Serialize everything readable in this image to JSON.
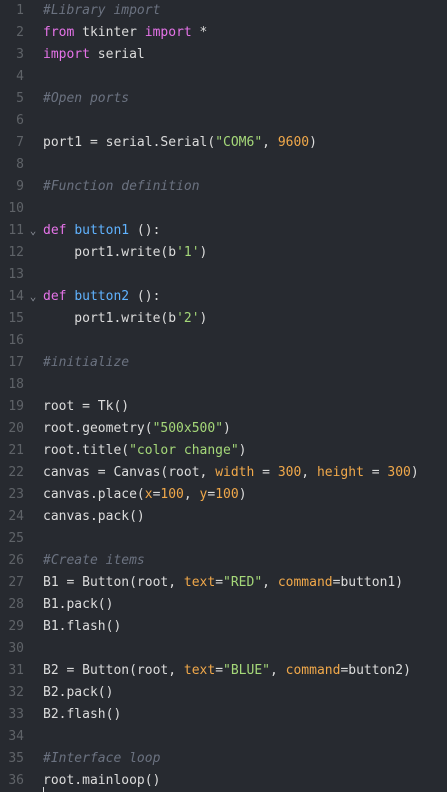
{
  "lines": [
    {
      "n": "1",
      "fold": "",
      "tokens": [
        {
          "c": "cm",
          "t": "#Library import"
        }
      ]
    },
    {
      "n": "2",
      "fold": "",
      "tokens": [
        {
          "c": "kw",
          "t": "from"
        },
        {
          "c": "txt",
          "t": " tkinter "
        },
        {
          "c": "kw",
          "t": "import"
        },
        {
          "c": "txt",
          "t": " *"
        }
      ]
    },
    {
      "n": "3",
      "fold": "",
      "tokens": [
        {
          "c": "kw",
          "t": "import"
        },
        {
          "c": "txt",
          "t": " serial"
        }
      ]
    },
    {
      "n": "4",
      "fold": "",
      "tokens": []
    },
    {
      "n": "5",
      "fold": "",
      "tokens": [
        {
          "c": "cm",
          "t": "#Open ports"
        }
      ]
    },
    {
      "n": "6",
      "fold": "",
      "tokens": []
    },
    {
      "n": "7",
      "fold": "",
      "tokens": [
        {
          "c": "txt",
          "t": "port1 = serial.Serial("
        },
        {
          "c": "str",
          "t": "\"COM6\""
        },
        {
          "c": "txt",
          "t": ", "
        },
        {
          "c": "num",
          "t": "9600"
        },
        {
          "c": "txt",
          "t": ")"
        }
      ]
    },
    {
      "n": "8",
      "fold": "",
      "tokens": []
    },
    {
      "n": "9",
      "fold": "",
      "tokens": [
        {
          "c": "cm",
          "t": "#Function definition"
        }
      ]
    },
    {
      "n": "10",
      "fold": "",
      "tokens": []
    },
    {
      "n": "11",
      "fold": "v",
      "tokens": [
        {
          "c": "kw",
          "t": "def"
        },
        {
          "c": "txt",
          "t": " "
        },
        {
          "c": "fn",
          "t": "button1"
        },
        {
          "c": "txt",
          "t": " ():"
        }
      ]
    },
    {
      "n": "12",
      "fold": "",
      "tokens": [
        {
          "c": "txt",
          "t": "    port1.write(b"
        },
        {
          "c": "str",
          "t": "'1'"
        },
        {
          "c": "txt",
          "t": ")"
        }
      ]
    },
    {
      "n": "13",
      "fold": "",
      "tokens": []
    },
    {
      "n": "14",
      "fold": "v",
      "tokens": [
        {
          "c": "kw",
          "t": "def"
        },
        {
          "c": "txt",
          "t": " "
        },
        {
          "c": "fn",
          "t": "button2"
        },
        {
          "c": "txt",
          "t": " ():"
        }
      ]
    },
    {
      "n": "15",
      "fold": "",
      "tokens": [
        {
          "c": "txt",
          "t": "    port1.write(b"
        },
        {
          "c": "str",
          "t": "'2'"
        },
        {
          "c": "txt",
          "t": ")"
        }
      ]
    },
    {
      "n": "16",
      "fold": "",
      "tokens": []
    },
    {
      "n": "17",
      "fold": "",
      "tokens": [
        {
          "c": "cm",
          "t": "#initialize"
        }
      ]
    },
    {
      "n": "18",
      "fold": "",
      "tokens": []
    },
    {
      "n": "19",
      "fold": "",
      "tokens": [
        {
          "c": "txt",
          "t": "root = Tk()"
        }
      ]
    },
    {
      "n": "20",
      "fold": "",
      "tokens": [
        {
          "c": "txt",
          "t": "root.geometry("
        },
        {
          "c": "str",
          "t": "\"500x500\""
        },
        {
          "c": "txt",
          "t": ")"
        }
      ]
    },
    {
      "n": "21",
      "fold": "",
      "tokens": [
        {
          "c": "txt",
          "t": "root.title("
        },
        {
          "c": "str",
          "t": "\"color change\""
        },
        {
          "c": "txt",
          "t": ")"
        }
      ]
    },
    {
      "n": "22",
      "fold": "",
      "tokens": [
        {
          "c": "txt",
          "t": "canvas = Canvas(root, "
        },
        {
          "c": "param",
          "t": "width"
        },
        {
          "c": "txt",
          "t": " = "
        },
        {
          "c": "num",
          "t": "300"
        },
        {
          "c": "txt",
          "t": ", "
        },
        {
          "c": "param",
          "t": "height"
        },
        {
          "c": "txt",
          "t": " = "
        },
        {
          "c": "num",
          "t": "300"
        },
        {
          "c": "txt",
          "t": ")"
        }
      ]
    },
    {
      "n": "23",
      "fold": "",
      "tokens": [
        {
          "c": "txt",
          "t": "canvas.place("
        },
        {
          "c": "param",
          "t": "x"
        },
        {
          "c": "txt",
          "t": "="
        },
        {
          "c": "num",
          "t": "100"
        },
        {
          "c": "txt",
          "t": ", "
        },
        {
          "c": "param",
          "t": "y"
        },
        {
          "c": "txt",
          "t": "="
        },
        {
          "c": "num",
          "t": "100"
        },
        {
          "c": "txt",
          "t": ")"
        }
      ]
    },
    {
      "n": "24",
      "fold": "",
      "tokens": [
        {
          "c": "txt",
          "t": "canvas.pack()"
        }
      ]
    },
    {
      "n": "25",
      "fold": "",
      "tokens": []
    },
    {
      "n": "26",
      "fold": "",
      "tokens": [
        {
          "c": "cm",
          "t": "#Create items"
        }
      ]
    },
    {
      "n": "27",
      "fold": "",
      "tokens": [
        {
          "c": "txt",
          "t": "B1 = Button(root, "
        },
        {
          "c": "param",
          "t": "text"
        },
        {
          "c": "txt",
          "t": "="
        },
        {
          "c": "str",
          "t": "\"RED\""
        },
        {
          "c": "txt",
          "t": ", "
        },
        {
          "c": "param",
          "t": "command"
        },
        {
          "c": "txt",
          "t": "=button1)"
        }
      ]
    },
    {
      "n": "28",
      "fold": "",
      "tokens": [
        {
          "c": "txt",
          "t": "B1.pack()"
        }
      ]
    },
    {
      "n": "29",
      "fold": "",
      "tokens": [
        {
          "c": "txt",
          "t": "B1.flash()"
        }
      ]
    },
    {
      "n": "30",
      "fold": "",
      "tokens": []
    },
    {
      "n": "31",
      "fold": "",
      "tokens": [
        {
          "c": "txt",
          "t": "B2 = Button(root, "
        },
        {
          "c": "param",
          "t": "text"
        },
        {
          "c": "txt",
          "t": "="
        },
        {
          "c": "str",
          "t": "\"BLUE\""
        },
        {
          "c": "txt",
          "t": ", "
        },
        {
          "c": "param",
          "t": "command"
        },
        {
          "c": "txt",
          "t": "=button2)"
        }
      ]
    },
    {
      "n": "32",
      "fold": "",
      "tokens": [
        {
          "c": "txt",
          "t": "B2.pack()"
        }
      ]
    },
    {
      "n": "33",
      "fold": "",
      "tokens": [
        {
          "c": "txt",
          "t": "B2.flash()"
        }
      ]
    },
    {
      "n": "34",
      "fold": "",
      "tokens": []
    },
    {
      "n": "35",
      "fold": "",
      "tokens": [
        {
          "c": "cm",
          "t": "#Interface loop"
        }
      ]
    },
    {
      "n": "36",
      "fold": "",
      "tokens": [
        {
          "c": "txt",
          "t": "root.mainloop()"
        }
      ]
    }
  ]
}
